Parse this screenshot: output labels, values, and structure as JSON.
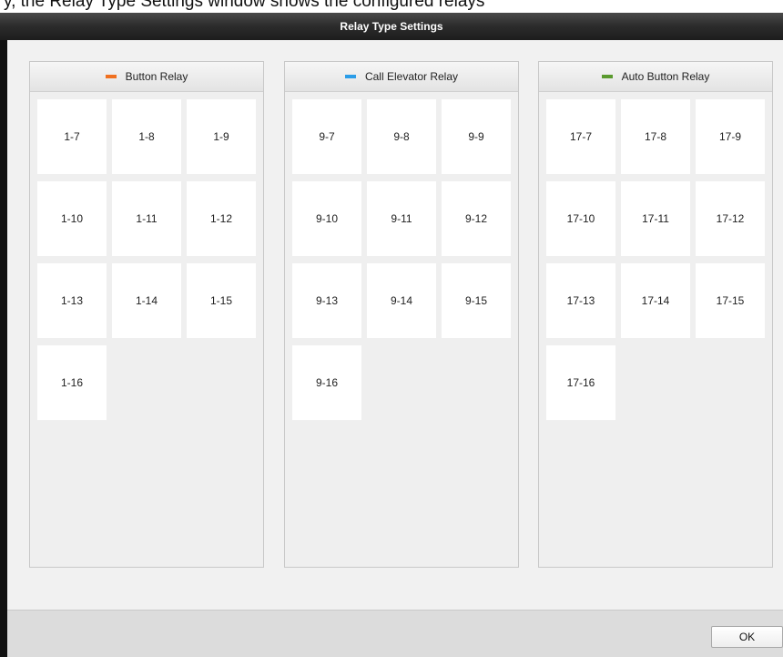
{
  "background_caption": "y, the Relay Type Settings window shows the configured relays",
  "dialog": {
    "title": "Relay Type Settings",
    "ok_label": "OK"
  },
  "panels": [
    {
      "title": "Button Relay",
      "accent": "#f07020",
      "relays": [
        "1-7",
        "1-8",
        "1-9",
        "1-10",
        "1-11",
        "1-12",
        "1-13",
        "1-14",
        "1-15",
        "1-16"
      ]
    },
    {
      "title": "Call Elevator Relay",
      "accent": "#2b9de8",
      "relays": [
        "9-7",
        "9-8",
        "9-9",
        "9-10",
        "9-11",
        "9-12",
        "9-13",
        "9-14",
        "9-15",
        "9-16"
      ]
    },
    {
      "title": "Auto Button Relay",
      "accent": "#5a9a2e",
      "relays": [
        "17-7",
        "17-8",
        "17-9",
        "17-10",
        "17-11",
        "17-12",
        "17-13",
        "17-14",
        "17-15",
        "17-16"
      ]
    }
  ]
}
